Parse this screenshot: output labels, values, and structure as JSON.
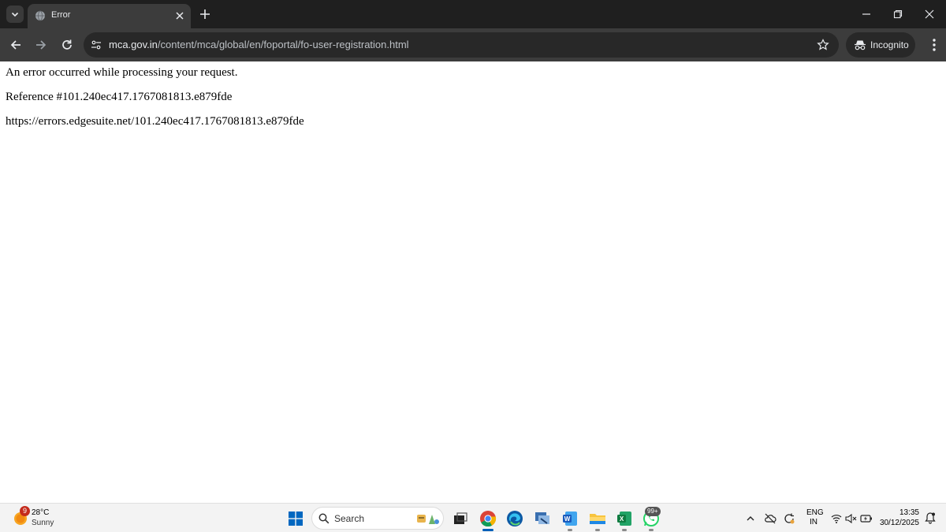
{
  "browser": {
    "tab": {
      "title": "Error"
    },
    "address": {
      "host": "mca.gov.in",
      "path": "/content/mca/global/en/foportal/fo-user-registration.html"
    },
    "incognito_label": "Incognito",
    "icons": [
      "tab-search-icon",
      "globe-icon",
      "close-icon",
      "plus-icon",
      "minimize-icon",
      "restore-icon",
      "window-close-icon",
      "back-arrow-icon",
      "forward-arrow-icon",
      "reload-icon",
      "site-info-icon",
      "star-icon",
      "incognito-icon",
      "more-vert-icon"
    ]
  },
  "page": {
    "message": "An error occurred while processing your request.",
    "reference": "Reference #101.240ec417.1767081813.e879fde",
    "error_url": "https://errors.edgesuite.net/101.240ec417.1767081813.e879fde"
  },
  "taskbar": {
    "weather": {
      "badge": "9",
      "temp": "28°C",
      "condition": "Sunny"
    },
    "search_label": "Search",
    "apps": [
      "file-explorer-art",
      "task-view",
      "chrome",
      "edge",
      "network-tool",
      "word",
      "file-explorer",
      "excel",
      "whatsapp"
    ],
    "whatsapp_badge": "99+",
    "language": {
      "line1": "ENG",
      "line2": "IN"
    },
    "clock": {
      "time": "13:35",
      "date": "30/12/2025"
    }
  },
  "colors": {
    "chrome_dark": "#1f1f1f",
    "toolbar": "#3c3c3c",
    "omnibox": "#282828",
    "taskbar": "#f3f3f3",
    "windows_blue": "#005fb8"
  }
}
